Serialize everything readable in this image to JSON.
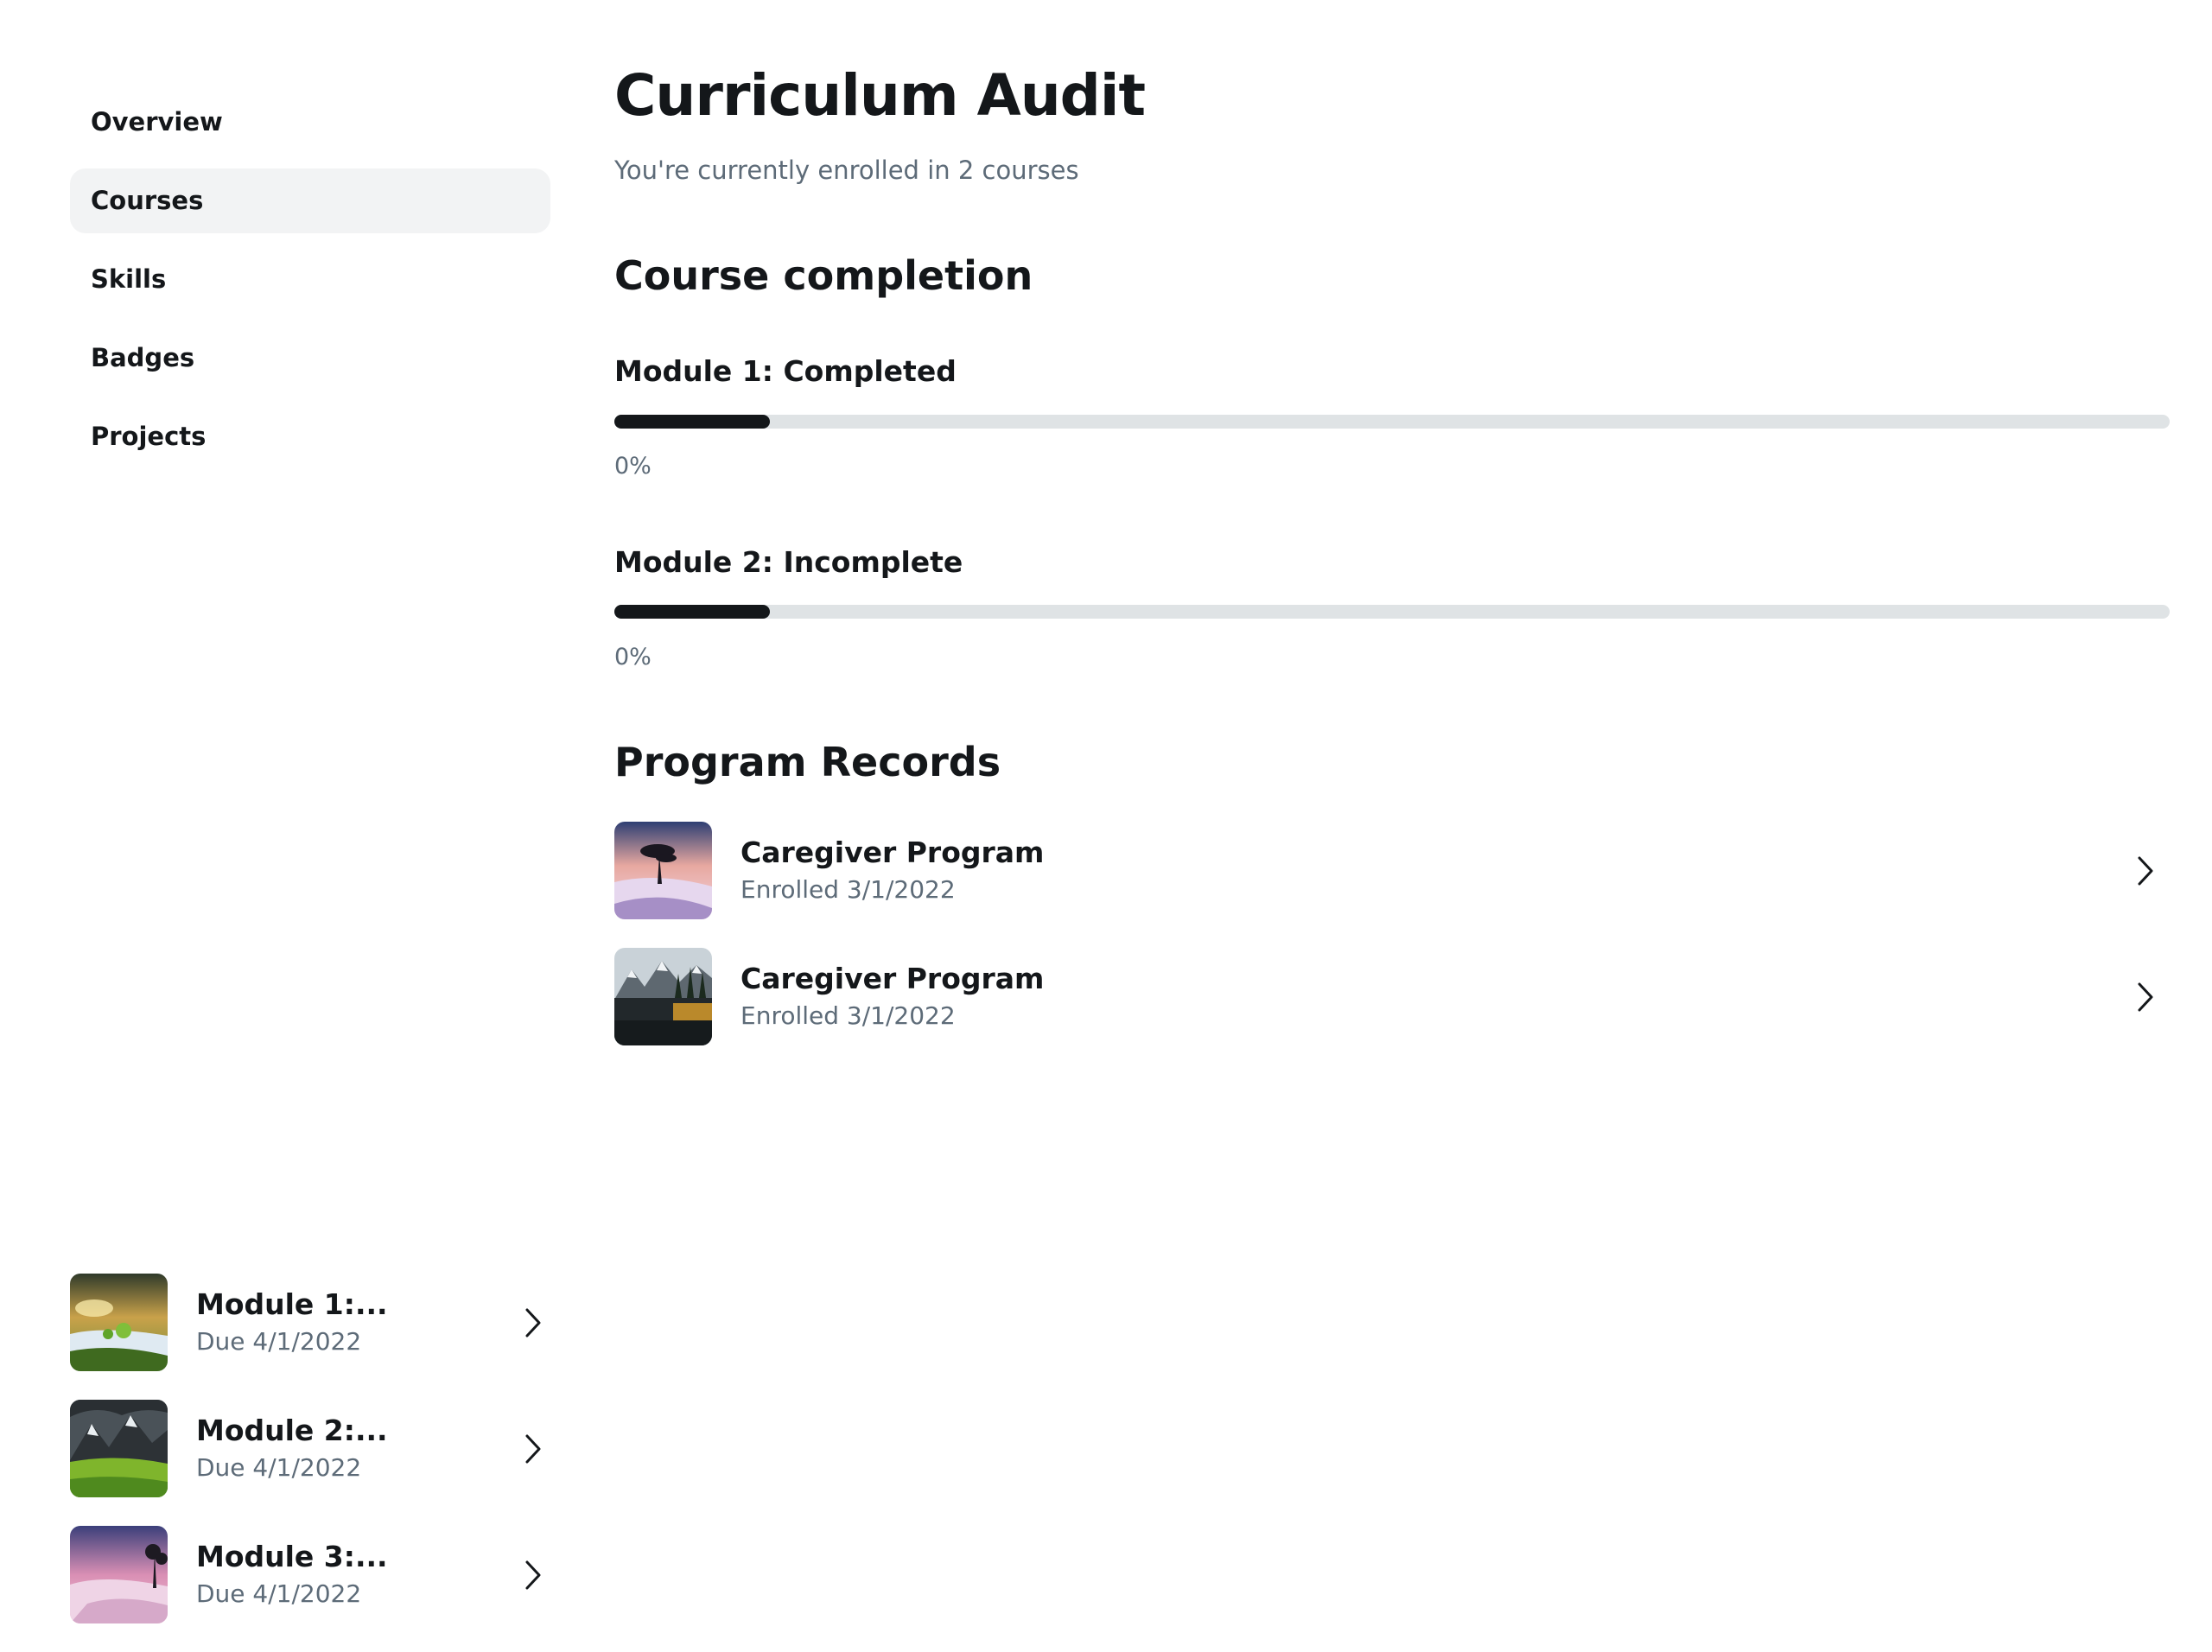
{
  "sidebar": {
    "nav": [
      {
        "label": "Overview",
        "active": false
      },
      {
        "label": "Courses",
        "active": true
      },
      {
        "label": "Skills",
        "active": false
      },
      {
        "label": "Badges",
        "active": false
      },
      {
        "label": "Projects",
        "active": false
      }
    ],
    "modules": [
      {
        "title": "Module 1:...",
        "due": "Due 4/1/2022",
        "icon": "chevron-right-icon"
      },
      {
        "title": "Module 2:...",
        "due": "Due 4/1/2022",
        "icon": "chevron-right-icon"
      },
      {
        "title": "Module 3:...",
        "due": "Due 4/1/2022",
        "icon": "chevron-right-icon"
      }
    ]
  },
  "main": {
    "title": "Curriculum Audit",
    "subtitle": "You're currently enrolled in 2 courses",
    "completion": {
      "heading": "Course completion",
      "modules": [
        {
          "label": "Module 1: Completed",
          "percent_text": "0%",
          "fill_fraction": 0.1
        },
        {
          "label": "Module 2: Incomplete",
          "percent_text": "0%",
          "fill_fraction": 0.1
        }
      ]
    },
    "records": {
      "heading": "Program Records",
      "items": [
        {
          "title": "Caregiver Program",
          "enrolled": "Enrolled 3/1/2022",
          "icon": "chevron-right-icon"
        },
        {
          "title": "Caregiver Program",
          "enrolled": "Enrolled 3/1/2022",
          "icon": "chevron-right-icon"
        }
      ]
    }
  },
  "colors": {
    "text": "#14171a",
    "muted": "#5d6b78",
    "active_nav_bg": "#f2f3f4",
    "progress_track": "#dfe3e5",
    "progress_fill": "#14171a"
  }
}
